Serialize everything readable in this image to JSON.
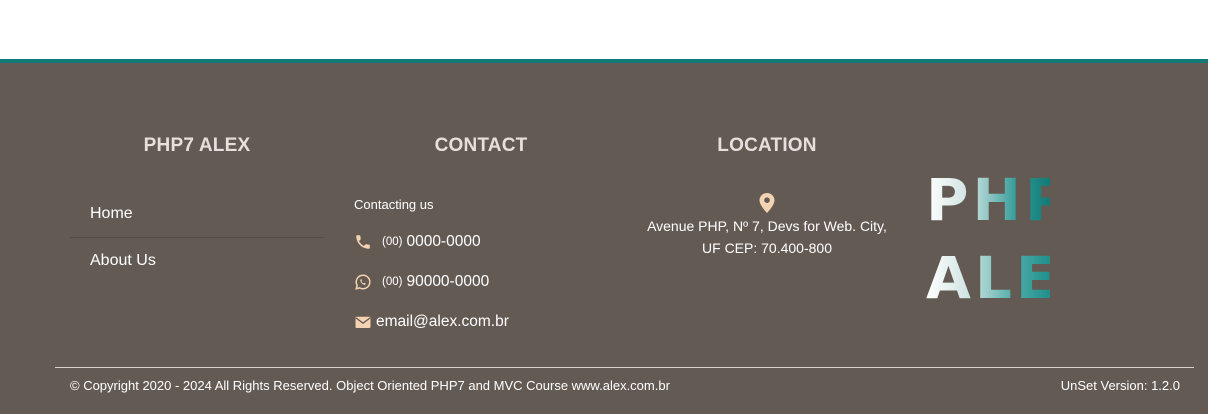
{
  "colors": {
    "accent": "#127a76",
    "footer_background": "#645a54",
    "icon": "#f3d3b1"
  },
  "footer": {
    "columns": {
      "brand_title": "PHP7 ALEX",
      "contact_title": "CONTACT",
      "location_title": "LOCATION"
    },
    "nav": [
      {
        "label": "Home"
      },
      {
        "label": "About Us"
      }
    ],
    "contact": {
      "intro": "Contacting us",
      "phone": {
        "icon": "phone-icon",
        "area": "(00)",
        "number": "0000-0000"
      },
      "whatsapp": {
        "icon": "whatsapp-icon",
        "area": "(00)",
        "number": "90000-0000"
      },
      "email": {
        "icon": "envelope-icon",
        "address": "email@alex.com.br"
      }
    },
    "location": {
      "icon": "map-pin-icon",
      "line1": "Avenue PHP, Nº 7, Devs for Web. City,",
      "line2": "UF CEP: 70.400-800"
    },
    "logo": {
      "line1": "PHP",
      "line2": "ALEX"
    },
    "copyright": "© Copyright 2020 - 2024 All Rights Reserved. Object Oriented PHP7 and MVC Course www.alex.com.br",
    "version": "UnSet Version: 1.2.0"
  }
}
